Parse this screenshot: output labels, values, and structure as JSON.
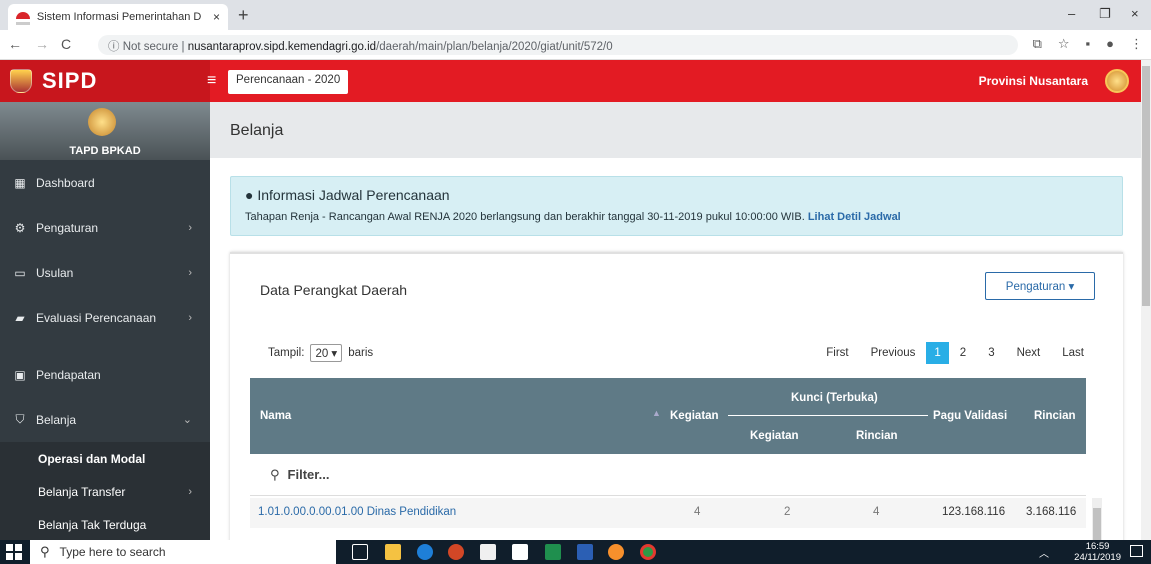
{
  "browser": {
    "tab_title": "Sistem Informasi Pemerintahan D",
    "tab_close": "×",
    "new_tab": "+",
    "win_min": "–",
    "win_restore": "❐",
    "win_close": "×",
    "back": "←",
    "forward": "→",
    "reload": "C",
    "not_secure": "ⓘ Not secure",
    "url_host": "nusantaraprov.sipd.kemendagri.go.id",
    "url_path": "/daerah/main/plan/belanja/2020/giat/unit/572/0"
  },
  "app": {
    "logo": "SIPD",
    "menu_icon": "≡",
    "plan_label": "Perencanaan - 2020",
    "province": "Provinsi Nusantara"
  },
  "sidebar": {
    "user": "TAPD BPKAD",
    "items": [
      {
        "label": "Dashboard",
        "icon": "▦",
        "arrow": ""
      },
      {
        "label": "Pengaturan",
        "icon": "⚙",
        "arrow": "›"
      },
      {
        "label": "Usulan",
        "icon": "▭",
        "arrow": "›"
      },
      {
        "label": "Evaluasi Perencanaan",
        "icon": "▰",
        "arrow": "›"
      },
      {
        "label": "Pendapatan",
        "icon": "▣",
        "arrow": ""
      },
      {
        "label": "Belanja",
        "icon": "⛉",
        "arrow": "⌄"
      }
    ],
    "sub_items": [
      {
        "label": "Operasi dan Modal",
        "arrow": ""
      },
      {
        "label": "Belanja Transfer",
        "arrow": "›"
      },
      {
        "label": "Belanja Tak Terduga",
        "arrow": ""
      }
    ]
  },
  "main": {
    "page_title": "Belanja",
    "info_title": "Informasi Jadwal Perencanaan",
    "info_text": "Tahapan Renja - Rancangan Awal RENJA 2020 berlangsung dan berakhir tanggal 30-11-2019 pukul 10:00:00 WIB.",
    "info_link": "Lihat Detil Jadwal",
    "panel_title": "Data Perangkat Daerah",
    "pengaturan_label": "Pengaturan ▾",
    "tampil_label": "Tampil:",
    "tampil_value": "20",
    "baris_label": "baris",
    "pager": {
      "first": "First",
      "previous": "Previous",
      "pages": [
        "1",
        "2",
        "3"
      ],
      "next": "Next",
      "last": "Last"
    },
    "table": {
      "headers": {
        "nama": "Nama",
        "kegiatan": "Kegiatan",
        "kunci": "Kunci (Terbuka)",
        "kunci_kegiatan": "Kegiatan",
        "kunci_rincian": "Rincian",
        "pagu": "Pagu Validasi",
        "rincian": "Rincian"
      },
      "filter_placeholder": "Filter...",
      "rows": [
        {
          "nama": "1.01.0.00.0.00.01.00 Dinas Pendidikan",
          "kegiatan": "4",
          "kunci_kegiatan": "2",
          "kunci_rincian": "4",
          "pagu": "123.168.116",
          "rincian": "3.168.116"
        }
      ]
    }
  },
  "taskbar": {
    "search_placeholder": "Type here to search",
    "time": "16:59",
    "date": "24/11/2019"
  }
}
